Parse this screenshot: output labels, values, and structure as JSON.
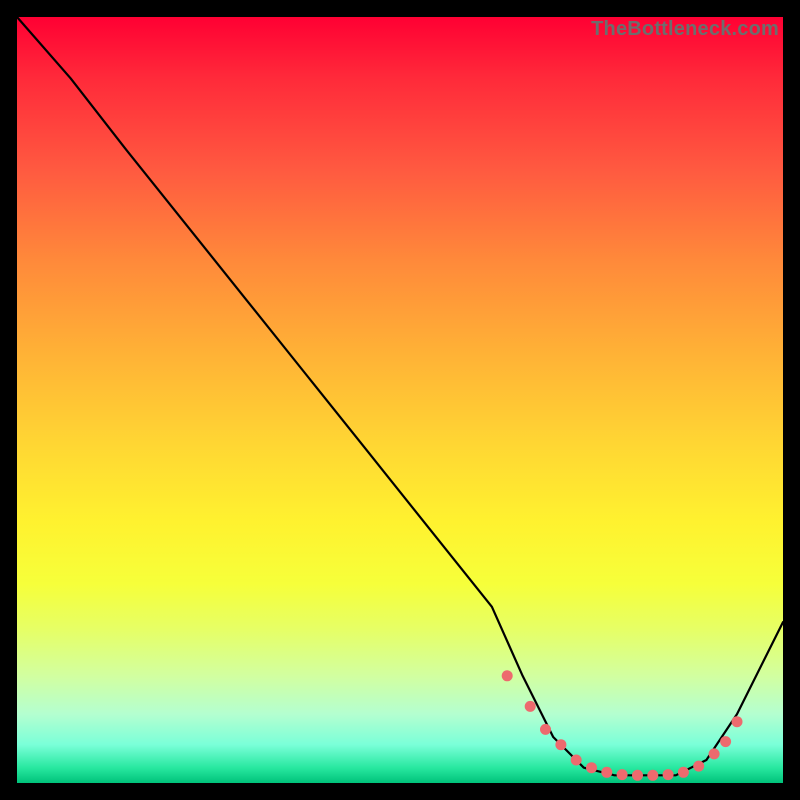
{
  "watermark": "TheBottleneck.com",
  "chart_data": {
    "type": "line",
    "title": "",
    "xlabel": "",
    "ylabel": "",
    "xlim": [
      0,
      100
    ],
    "ylim": [
      0,
      100
    ],
    "grid": false,
    "series": [
      {
        "name": "curve",
        "color": "#000000",
        "x": [
          0,
          7,
          14,
          22,
          30,
          38,
          46,
          54,
          62,
          66,
          70,
          74,
          78,
          82,
          86,
          90,
          94,
          100
        ],
        "y": [
          100,
          92,
          83,
          73,
          63,
          53,
          43,
          33,
          23,
          14,
          6,
          2,
          1,
          1,
          1,
          3,
          9,
          21
        ]
      }
    ],
    "markers": {
      "name": "highlight-points",
      "color": "#ed6a6e",
      "x": [
        64,
        67,
        69,
        71,
        73,
        75,
        77,
        79,
        81,
        83,
        85,
        87,
        89,
        91,
        92.5,
        94
      ],
      "y": [
        14,
        10,
        7,
        5,
        3,
        2,
        1.4,
        1.1,
        1,
        1,
        1.1,
        1.4,
        2.2,
        3.8,
        5.4,
        8
      ]
    },
    "background": "rainbow-vertical-gradient"
  }
}
